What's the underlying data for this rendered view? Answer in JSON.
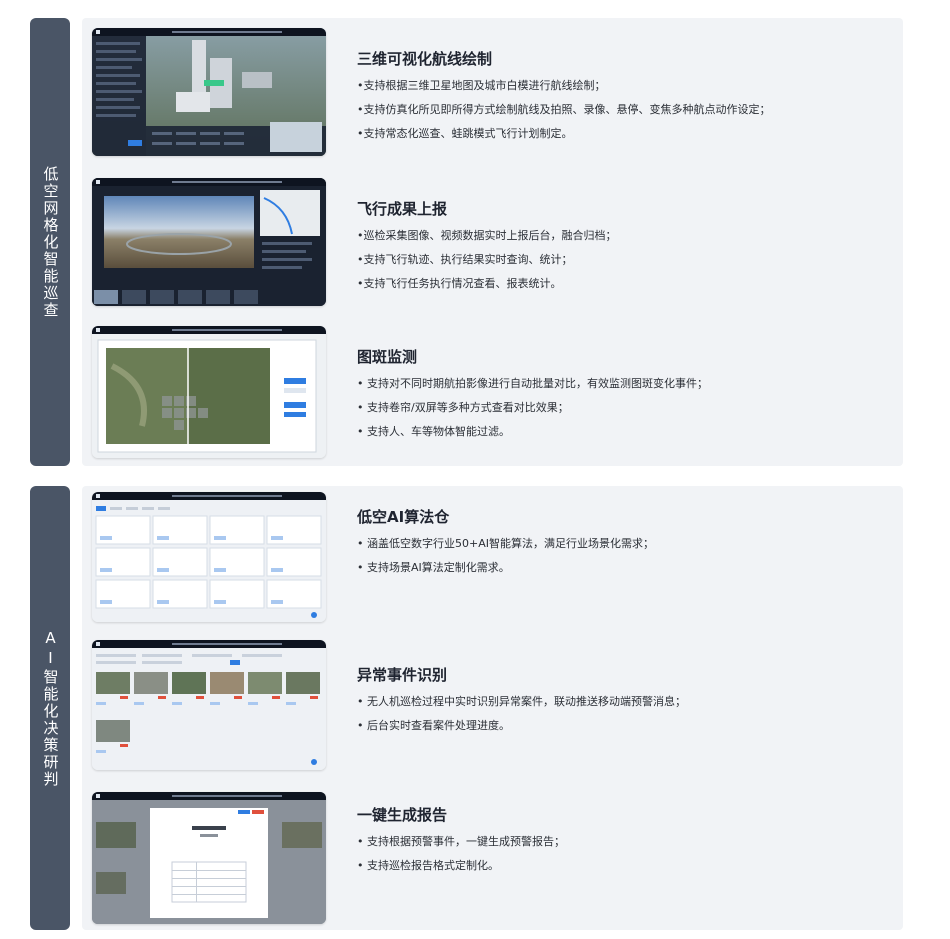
{
  "sections": [
    {
      "label": "低空网格化智能巡查",
      "features": [
        {
          "title": "三维可视化航线绘制",
          "items": [
            "•支持根据三维卫星地图及城市白模进行航线绘制；",
            "•支持仿真化所见即所得方式绘制航线及拍照、录像、悬停、变焦多种航点动作设定；",
            "•支持常态化巡查、蛙跳模式飞行计划制定。"
          ]
        },
        {
          "title": "飞行成果上报",
          "items": [
            "•巡检采集图像、视频数据实时上报后台，融合归档；",
            "•支持飞行轨迹、执行结果实时查询、统计；",
            "•支持飞行任务执行情况查看、报表统计。"
          ]
        },
        {
          "title": "图斑监测",
          "items": [
            "• 支持对不同时期航拍影像进行自动批量对比，有效监测图斑变化事件；",
            "• 支持卷帘/双屏等多种方式查看对比效果；",
            "• 支持人、车等物体智能过滤。"
          ]
        }
      ]
    },
    {
      "label": "AI智能化决策研判",
      "features": [
        {
          "title": "低空AI算法仓",
          "items": [
            "• 涵盖低空数字行业50+AI智能算法，满足行业场景化需求；",
            "• 支持场景AI算法定制化需求。"
          ]
        },
        {
          "title": "异常事件识别",
          "items": [
            "• 无人机巡检过程中实时识别异常案件，联动推送移动端预警消息；",
            "• 后台实时查看案件处理进度。"
          ]
        },
        {
          "title": "一键生成报告",
          "items": [
            "• 支持根据预警事件，一键生成预警报告；",
            "• 支持巡检报告格式定制化。"
          ]
        }
      ]
    }
  ],
  "icons": {
    "s0": "3d-route-planning-screenshot",
    "s1": "flight-results-screenshot",
    "s2": "patch-monitoring-screenshot",
    "s3": "ai-algorithm-store-screenshot",
    "s4": "anomaly-detection-screenshot",
    "s5": "report-generation-screenshot"
  },
  "colors": {
    "side_tab": "#4a5566",
    "panel": "#f1f3f6",
    "accent": "#2f7de1"
  }
}
